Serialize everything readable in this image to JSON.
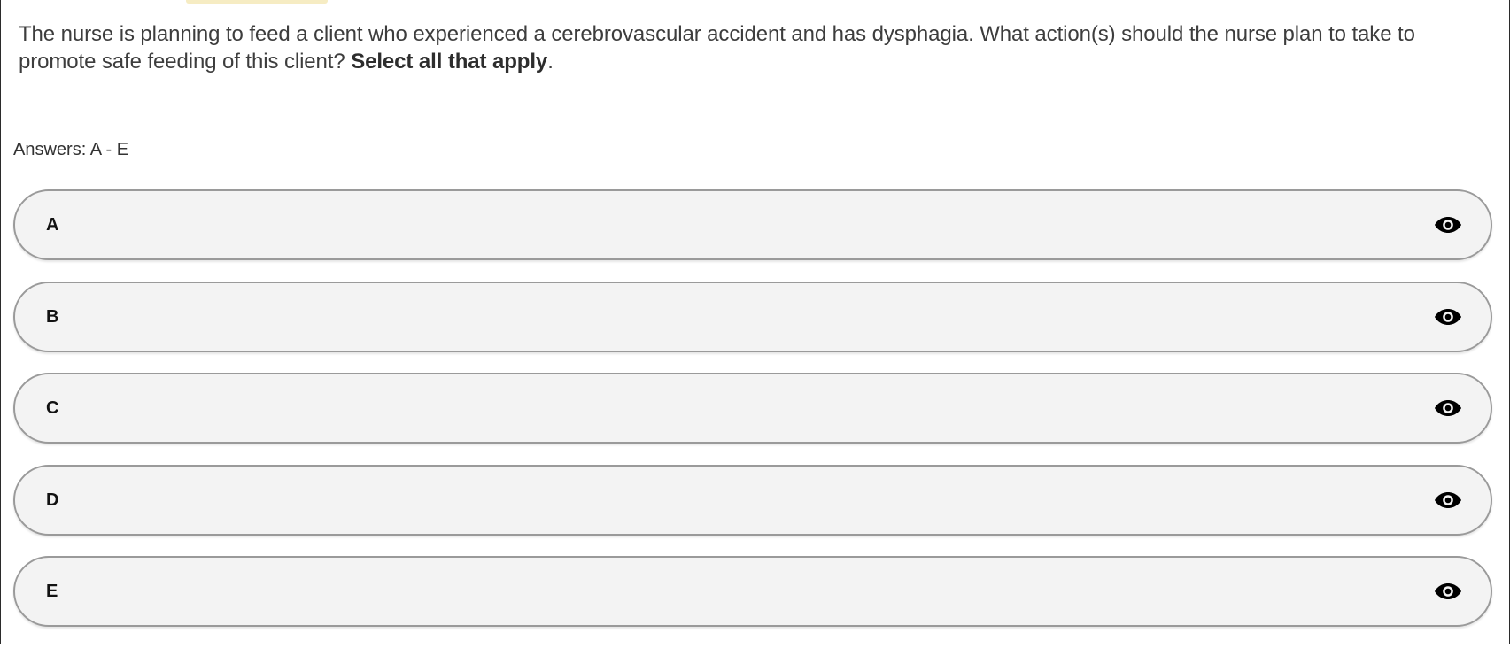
{
  "question": {
    "text": "The nurse is planning to feed a client who experienced a cerebrovascular accident and has dysphagia. What action(s) should the nurse plan to take to promote safe feeding of this client?",
    "emphasis": "Select all that apply",
    "trailing": "."
  },
  "answers_label": "Answers: A - E",
  "options": [
    {
      "letter": "A",
      "text": "",
      "icon": "eye-icon"
    },
    {
      "letter": "B",
      "text": "",
      "icon": "eye-icon"
    },
    {
      "letter": "C",
      "text": "",
      "icon": "eye-icon"
    },
    {
      "letter": "D",
      "text": "",
      "icon": "eye-icon"
    },
    {
      "letter": "E",
      "text": "",
      "icon": "eye-icon"
    }
  ],
  "colors": {
    "option_background": "#f3f3f3",
    "option_border": "#9a9a9a",
    "text": "#3d3d3d"
  }
}
